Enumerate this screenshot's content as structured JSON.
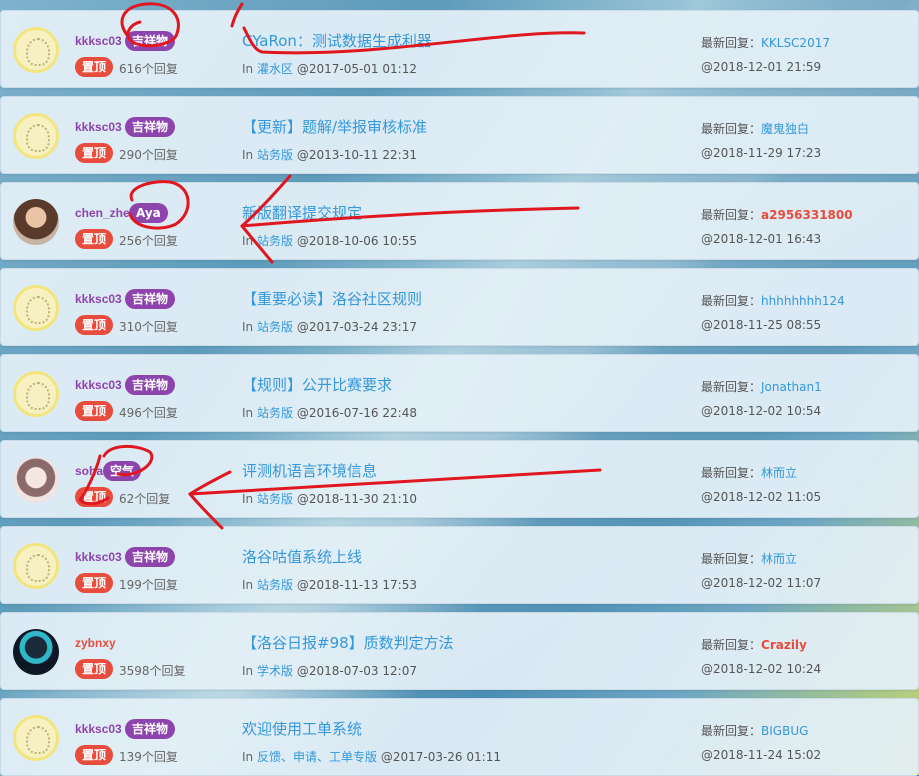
{
  "reply_suffix": "个回复",
  "pin_label": "置顶",
  "last_reply_label": "最新回复：",
  "in_label": "In",
  "threads": [
    {
      "author": "kkksc03",
      "badge": "吉祥物",
      "title": "CYaRon：测试数据生成利器",
      "forum": "灌水区",
      "posted": "@2017-05-01 01:12",
      "replies": "616",
      "last_user": "KKLSC2017",
      "last_time": "@2018-12-01 21:59"
    },
    {
      "author": "kkksc03",
      "badge": "吉祥物",
      "title": "【更新】题解/举报审核标准",
      "forum": "站务版",
      "posted": "@2013-10-11 22:31",
      "replies": "290",
      "last_user": "魔鬼独白",
      "last_time": "@2018-11-29 17:23"
    },
    {
      "author": "chen_zhe",
      "badge": "Aya",
      "title": "新版翻译提交规定",
      "forum": "站务版",
      "posted": "@2018-10-06 10:55",
      "replies": "256",
      "last_user": "a2956331800",
      "last_time": "@2018-12-01 16:43"
    },
    {
      "author": "kkksc03",
      "badge": "吉祥物",
      "title": "【重要必读】洛谷社区规则",
      "forum": "站务版",
      "posted": "@2017-03-24 23:17",
      "replies": "310",
      "last_user": "hhhhhhhh124",
      "last_time": "@2018-11-25 08:55"
    },
    {
      "author": "kkksc03",
      "badge": "吉祥物",
      "title": "【规则】公开比赛要求",
      "forum": "站务版",
      "posted": "@2016-07-16 22:48",
      "replies": "496",
      "last_user": "Jonathan1",
      "last_time": "@2018-12-02 10:54"
    },
    {
      "author": "soha",
      "badge": "空气",
      "title": "评测机语言环境信息",
      "forum": "站务版",
      "posted": "@2018-11-30 21:10",
      "replies": "62",
      "last_user": "林而立",
      "last_time": "@2018-12-02 11:05"
    },
    {
      "author": "kkksc03",
      "badge": "吉祥物",
      "title": "洛谷咕值系统上线",
      "forum": "站务版",
      "posted": "@2018-11-13 17:53",
      "replies": "199",
      "last_user": "林而立",
      "last_time": "@2018-12-02 11:07"
    },
    {
      "author": "zybnxy",
      "badge": "",
      "title": "【洛谷日报#98】质数判定方法",
      "forum": "学术版",
      "posted": "@2018-07-03 12:07",
      "replies": "3598",
      "last_user": "Crazily",
      "last_time": "@2018-12-02 10:24"
    },
    {
      "author": "kkksc03",
      "badge": "吉祥物",
      "title": "欢迎使用工单系统",
      "forum": "反馈、申请、工单专版",
      "posted": "@2017-03-26 01:11",
      "replies": "139",
      "last_user": "BIGBUG",
      "last_time": "@2018-11-24 15:02"
    }
  ],
  "colors": {
    "title": "#3498db",
    "badge": "#8e44ad",
    "pin": "#e74c3c",
    "annotation": "#e0171f"
  }
}
